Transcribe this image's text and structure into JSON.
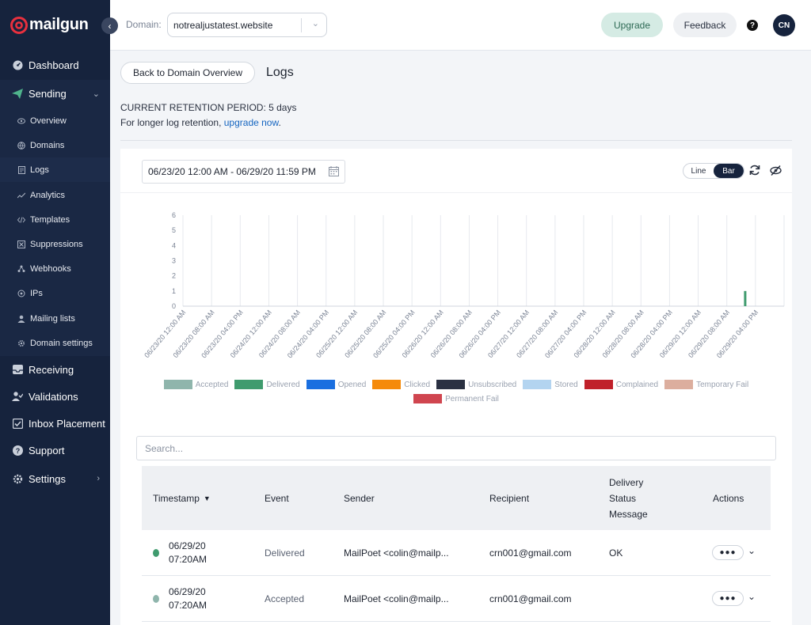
{
  "brand": {
    "name": "mailgun",
    "accent": "#e8303e"
  },
  "sidebar": {
    "items": [
      {
        "label": "Dashboard",
        "icon": "dashboard-icon"
      },
      {
        "label": "Sending",
        "icon": "send-icon"
      },
      {
        "label": "Receiving",
        "icon": "inbox-icon"
      },
      {
        "label": "Validations",
        "icon": "user-check-icon"
      },
      {
        "label": "Inbox Placement",
        "icon": "checkbox-icon"
      },
      {
        "label": "Support",
        "icon": "help-circle-icon"
      },
      {
        "label": "Settings",
        "icon": "gear-icon"
      }
    ],
    "sending_sub": [
      {
        "label": "Overview",
        "icon": "eye-icon"
      },
      {
        "label": "Domains",
        "icon": "globe-icon"
      },
      {
        "label": "Logs",
        "icon": "document-icon"
      },
      {
        "label": "Analytics",
        "icon": "chart-line-icon"
      },
      {
        "label": "Templates",
        "icon": "code-icon"
      },
      {
        "label": "Suppressions",
        "icon": "block-icon"
      },
      {
        "label": "Webhooks",
        "icon": "webhook-icon"
      },
      {
        "label": "IPs",
        "icon": "location-icon"
      },
      {
        "label": "Mailing lists",
        "icon": "person-icon"
      },
      {
        "label": "Domain settings",
        "icon": "cog-icon"
      }
    ],
    "active": "Logs"
  },
  "header": {
    "domain_label": "Domain:",
    "domain_value": "notrealjustatest.website",
    "upgrade": "Upgrade",
    "feedback": "Feedback",
    "help": "?",
    "avatar": "CN"
  },
  "page": {
    "back": "Back to Domain Overview",
    "title": "Logs",
    "retention": "CURRENT RETENTION PERIOD: 5 days",
    "retention_note": "For longer log retention,",
    "upgrade_link": "upgrade now",
    "retention_end": "."
  },
  "chart_controls": {
    "date_range": "06/23/20 12:00 AM - 06/29/20 11:59 PM",
    "line": "Line",
    "bar": "Bar",
    "selected": "Bar"
  },
  "chart_data": {
    "type": "bar",
    "categories": [
      "06/23/20 12:00 AM",
      "06/23/20 08:00 AM",
      "06/23/20 04:00 PM",
      "06/24/20 12:00 AM",
      "06/24/20 08:00 AM",
      "06/24/20 04:00 PM",
      "06/25/20 12:00 AM",
      "06/25/20 08:00 AM",
      "06/25/20 04:00 PM",
      "06/26/20 12:00 AM",
      "06/26/20 08:00 AM",
      "06/26/20 04:00 PM",
      "06/27/20 12:00 AM",
      "06/27/20 08:00 AM",
      "06/27/20 04:00 PM",
      "06/28/20 12:00 AM",
      "06/28/20 08:00 AM",
      "06/28/20 04:00 PM",
      "06/29/20 12:00 AM",
      "06/29/20 08:00 AM",
      "06/29/20 04:00 PM"
    ],
    "ylim": [
      0,
      6
    ],
    "yticks": [
      0,
      1,
      2,
      3,
      4,
      5,
      6
    ],
    "series": [
      {
        "name": "Accepted",
        "color": "#8fb5ac",
        "values": [
          0,
          0,
          0,
          0,
          0,
          0,
          0,
          0,
          0,
          0,
          0,
          0,
          0,
          0,
          0,
          0,
          0,
          0,
          0,
          0,
          0
        ]
      },
      {
        "name": "Delivered",
        "color": "#3f9b6e",
        "values": [
          0,
          0,
          0,
          0,
          0,
          0,
          0,
          0,
          0,
          0,
          0,
          0,
          0,
          0,
          0,
          0,
          0,
          0,
          0,
          1,
          0
        ]
      },
      {
        "name": "Opened",
        "color": "#1a6fe0",
        "values": [
          0,
          0,
          0,
          0,
          0,
          0,
          0,
          0,
          0,
          0,
          0,
          0,
          0,
          0,
          0,
          0,
          0,
          0,
          0,
          0,
          0
        ]
      },
      {
        "name": "Clicked",
        "color": "#f58a0a",
        "values": [
          0,
          0,
          0,
          0,
          0,
          0,
          0,
          0,
          0,
          0,
          0,
          0,
          0,
          0,
          0,
          0,
          0,
          0,
          0,
          0,
          0
        ]
      },
      {
        "name": "Unsubscribed",
        "color": "#2a3142",
        "values": [
          0,
          0,
          0,
          0,
          0,
          0,
          0,
          0,
          0,
          0,
          0,
          0,
          0,
          0,
          0,
          0,
          0,
          0,
          0,
          0,
          0
        ]
      },
      {
        "name": "Stored",
        "color": "#b3d4f0",
        "values": [
          0,
          0,
          0,
          0,
          0,
          0,
          0,
          0,
          0,
          0,
          0,
          0,
          0,
          0,
          0,
          0,
          0,
          0,
          0,
          0,
          0
        ]
      },
      {
        "name": "Complained",
        "color": "#c0202a",
        "values": [
          0,
          0,
          0,
          0,
          0,
          0,
          0,
          0,
          0,
          0,
          0,
          0,
          0,
          0,
          0,
          0,
          0,
          0,
          0,
          0,
          0
        ]
      },
      {
        "name": "Temporary Fail",
        "color": "#dcae9e",
        "values": [
          0,
          0,
          0,
          0,
          0,
          0,
          0,
          0,
          0,
          0,
          0,
          0,
          0,
          0,
          0,
          0,
          0,
          0,
          0,
          0,
          0
        ]
      },
      {
        "name": "Permanent Fail",
        "color": "#d0454f",
        "values": [
          0,
          0,
          0,
          0,
          0,
          0,
          0,
          0,
          0,
          0,
          0,
          0,
          0,
          0,
          0,
          0,
          0,
          0,
          0,
          0,
          0
        ]
      }
    ],
    "grid": true,
    "legend": "bottom"
  },
  "search": {
    "placeholder": "Search..."
  },
  "table": {
    "headers": {
      "timestamp": "Timestamp",
      "event": "Event",
      "sender": "Sender",
      "recipient": "Recipient",
      "status_1": "Delivery",
      "status_2": "Status",
      "status_3": "Message",
      "actions": "Actions"
    },
    "rows": [
      {
        "date": "06/29/20",
        "time": "07:20AM",
        "event": "Delivered",
        "sender": "MailPoet <colin@mailp...",
        "recipient": "crn001@gmail.com",
        "status": "OK",
        "dot_color": "#3f9b6e"
      },
      {
        "date": "06/29/20",
        "time": "07:20AM",
        "event": "Accepted",
        "sender": "MailPoet <colin@mailp...",
        "recipient": "crn001@gmail.com",
        "status": "",
        "dot_color": "#8fb5ac"
      }
    ]
  }
}
